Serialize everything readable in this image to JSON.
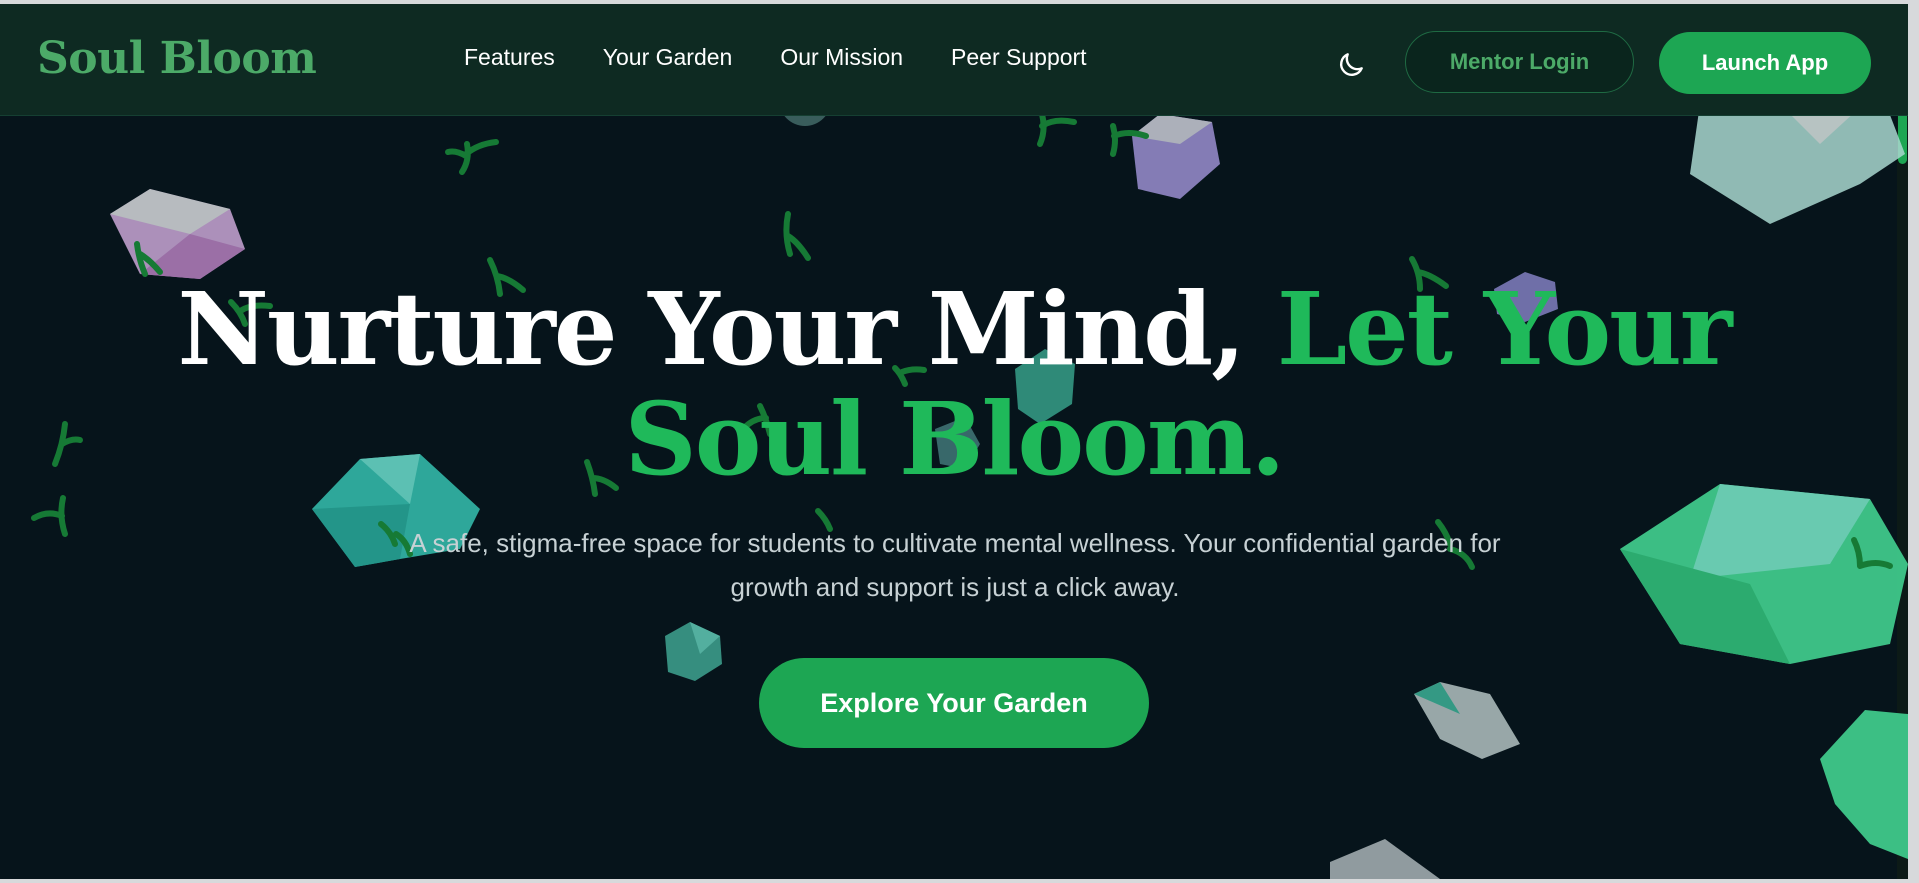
{
  "colors": {
    "background": "#06141b",
    "navbar": "#0e2a22",
    "accent": "#1da653",
    "brand": "#4caa68",
    "headline_accent": "#1fb95a"
  },
  "navbar": {
    "brand": "Soul Bloom",
    "links": [
      {
        "label": "Features"
      },
      {
        "label": "Your Garden"
      },
      {
        "label": "Our Mission"
      },
      {
        "label": "Peer Support"
      }
    ],
    "theme_toggle_icon": "moon-icon",
    "mentor_login_label": "Mentor Login",
    "launch_app_label": "Launch App"
  },
  "hero": {
    "title_main": "Nurture Your Mind, ",
    "title_accent": "Let Your Soul Bloom.",
    "subtitle": "A safe, stigma-free space for students to cultivate mental wellness. Your confidential garden for growth and support is just a click away.",
    "cta_label": "Explore Your Garden"
  },
  "decorations": {
    "shape_icon": "crystal-gem-icon",
    "sprout_icon": "sprout-icon"
  }
}
